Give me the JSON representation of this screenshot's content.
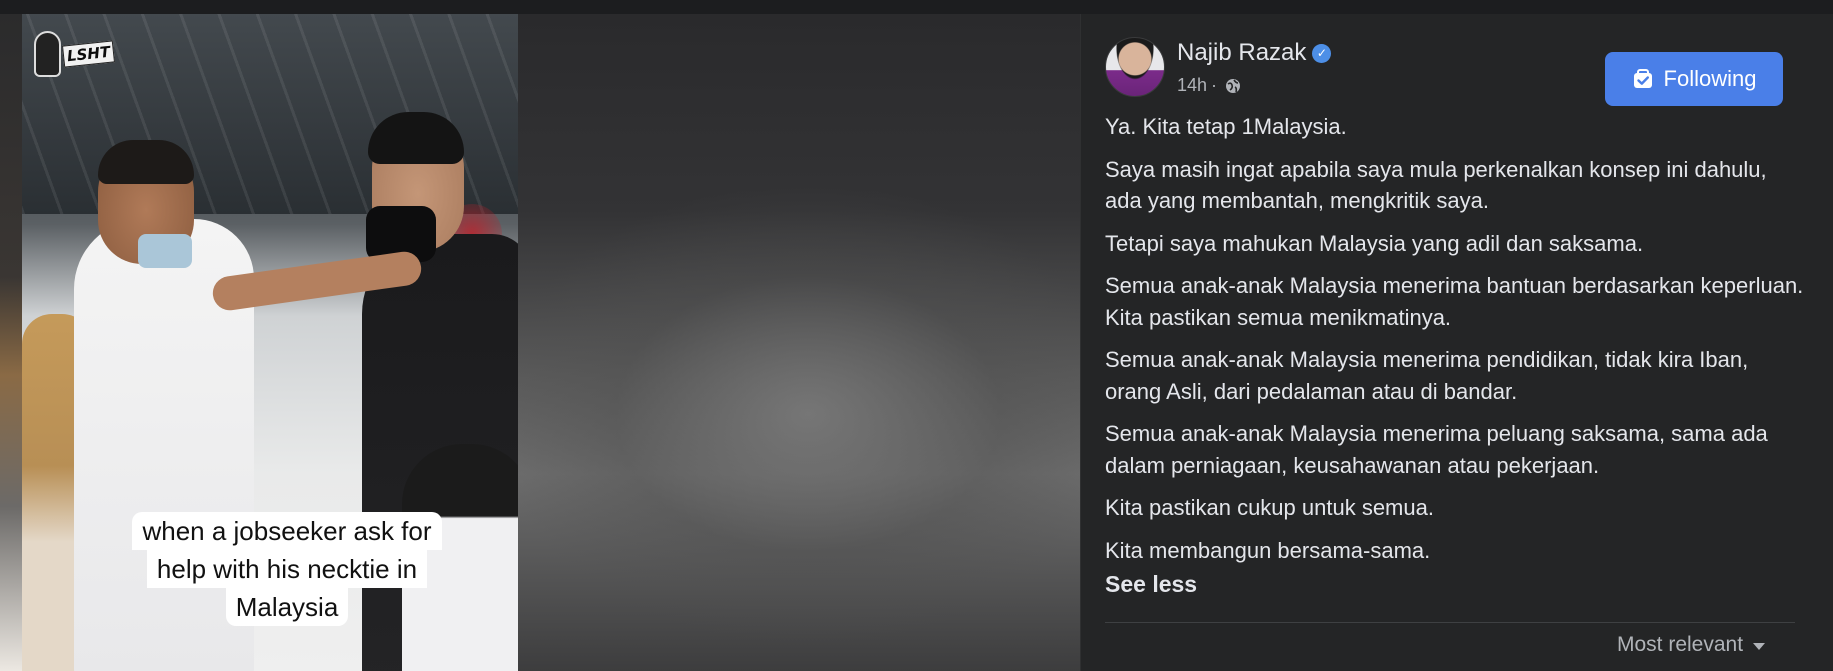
{
  "video": {
    "caption_lines": [
      "when a jobseeker ask for",
      "help with his necktie in",
      "Malaysia"
    ],
    "watermark": "LSHT"
  },
  "post": {
    "author": "Najib Razak",
    "time": "14h",
    "time_separator": "·",
    "follow_label": "Following",
    "paragraphs": [
      "Ya. Kita tetap 1Malaysia.",
      "Saya masih ingat apabila saya mula perkenalkan konsep ini dahulu, ada yang membantah, mengkritik saya.",
      "Tetapi saya mahukan Malaysia yang adil dan saksama.",
      "Semua anak-anak Malaysia menerima bantuan berdasarkan keperluan. Kita pastikan semua menikmatinya.",
      "Semua anak-anak Malaysia menerima pendidikan, tidak kira Iban, orang Asli, dari pedalaman atau di bandar.",
      "Semua anak-anak Malaysia menerima peluang saksama, sama ada dalam perniagaan, keusahawanan atau pekerjaan.",
      "Kita pastikan cukup untuk semua.",
      "Kita membangun bersama-sama."
    ],
    "see_less": "See less",
    "sort_label": "Most relevant"
  },
  "icons": {
    "verified": "verified-badge-icon",
    "privacy": "globe-icon",
    "follow": "following-check-icon",
    "sort": "caret-down-icon"
  },
  "colors": {
    "accent": "#4a7fe8",
    "panel": "#242526",
    "text": "#e4e6eb",
    "muted": "#b0b3b8"
  }
}
